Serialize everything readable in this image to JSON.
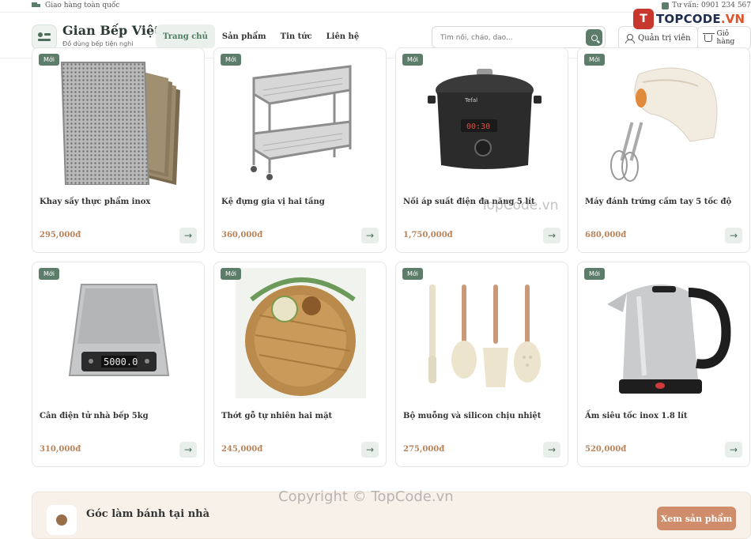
{
  "topbar": {
    "shipping": "Giao hàng toàn quốc",
    "hotline": "Tư vấn: 0901 234 567"
  },
  "brand": {
    "name": "Gian Bếp Việt",
    "tagline": "Đồ dùng bếp tiện nghi"
  },
  "nav": {
    "items": [
      {
        "label": "Trang chủ",
        "active": true
      },
      {
        "label": "Sản phẩm",
        "active": false
      },
      {
        "label": "Tin tức",
        "active": false
      },
      {
        "label": "Liên hệ",
        "active": false
      }
    ]
  },
  "search": {
    "placeholder": "Tìm nồi, chảo, dao..."
  },
  "header_buttons": {
    "admin": "Quản trị viên",
    "cart": "Giỏ hàng"
  },
  "watermark_logo": {
    "badge": "T",
    "text_a": "TOPCODE",
    "text_b": ".VN"
  },
  "products": [
    {
      "badge": "Mới",
      "name": "Khay sấy thực phẩm inox",
      "price": "295,000đ",
      "image": "steel-drying-trays"
    },
    {
      "badge": "Mới",
      "name": "Kệ đựng gia vị hai tầng",
      "price": "360,000đ",
      "image": "two-tier-spice-rack"
    },
    {
      "badge": "Mới",
      "name": "Nồi áp suất điện đa năng 5 lít",
      "price": "1,750,000đ",
      "image": "electric-pressure-cooker"
    },
    {
      "badge": "Mới",
      "name": "Máy đánh trứng cầm tay 5 tốc độ",
      "price": "680,000đ",
      "image": "hand-mixer"
    },
    {
      "badge": "Mới",
      "name": "Cân điện tử nhà bếp 5kg",
      "price": "310,000đ",
      "image": "kitchen-scale",
      "display": "5000.0"
    },
    {
      "badge": "Mới",
      "name": "Thớt gỗ tự nhiên hai mặt",
      "price": "245,000đ",
      "image": "wooden-cutting-board"
    },
    {
      "badge": "Mới",
      "name": "Bộ muỗng và silicon chịu nhiệt",
      "price": "275,000đ",
      "image": "silicone-utensil-set"
    },
    {
      "badge": "Mới",
      "name": "Ấm siêu tốc inox 1.8 lít",
      "price": "520,000đ",
      "image": "electric-kettle"
    }
  ],
  "banner": {
    "title": "Góc làm bánh tại nhà",
    "button": "Xem sản phẩm"
  },
  "watermarks": {
    "center": "TopCode.vn",
    "bottom": "Copyright © TopCode.vn"
  },
  "colors": {
    "accent_green": "#5d7d6b",
    "price_brown": "#b9835a",
    "banner_button": "#cf8d6c"
  }
}
